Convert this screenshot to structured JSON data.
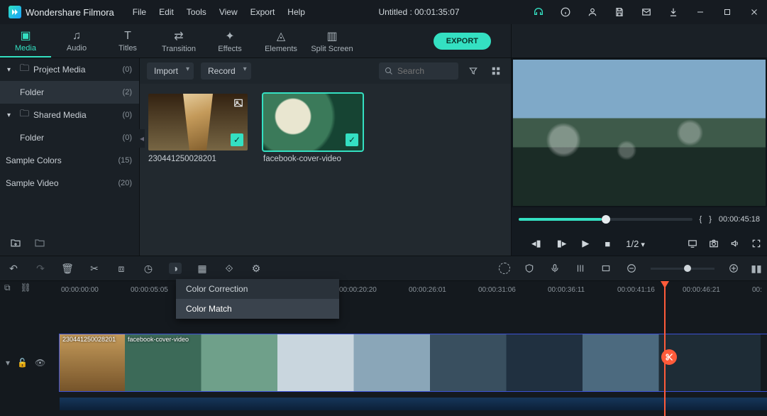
{
  "app": {
    "title": "Wondershare Filmora"
  },
  "menu": {
    "file": "File",
    "edit": "Edit",
    "tools": "Tools",
    "view": "View",
    "export": "Export",
    "help": "Help"
  },
  "project": {
    "title": "Untitled : 00:01:35:07"
  },
  "tabs": {
    "media": "Media",
    "audio": "Audio",
    "titles": "Titles",
    "transition": "Transition",
    "effects": "Effects",
    "elements": "Elements",
    "split": "Split Screen"
  },
  "export_btn": "EXPORT",
  "sidebar": {
    "project_media": "Project Media",
    "project_media_count": "(0)",
    "folder": "Folder",
    "folder_count": "(2)",
    "shared_media": "Shared Media",
    "shared_media_count": "(0)",
    "shared_folder": "Folder",
    "shared_folder_count": "(0)",
    "sample_colors": "Sample Colors",
    "sample_colors_count": "(15)",
    "sample_video": "Sample Video",
    "sample_video_count": "(20)"
  },
  "media_top": {
    "import": "Import",
    "record": "Record",
    "search": "Search"
  },
  "media": {
    "items": [
      {
        "name": "230441250028201"
      },
      {
        "name": "facebook-cover-video"
      }
    ]
  },
  "preview": {
    "brace_in": "{",
    "brace_out": "}",
    "timecode": "00:00:45:18",
    "speed": "1/2"
  },
  "color_menu": {
    "correction": "Color Correction",
    "match": "Color Match"
  },
  "ruler": {
    "t0": "00:00:00:00",
    "t1": "00:00:05:05",
    "t2": "00:00:20:20",
    "t3": "00:00:26:01",
    "t4": "00:00:31:06",
    "t5": "00:00:36:11",
    "t6": "00:00:41:16",
    "t7": "00:00:46:21",
    "t8": "00:"
  },
  "clips": {
    "a": "230441250028201",
    "b": "facebook-cover-video"
  }
}
